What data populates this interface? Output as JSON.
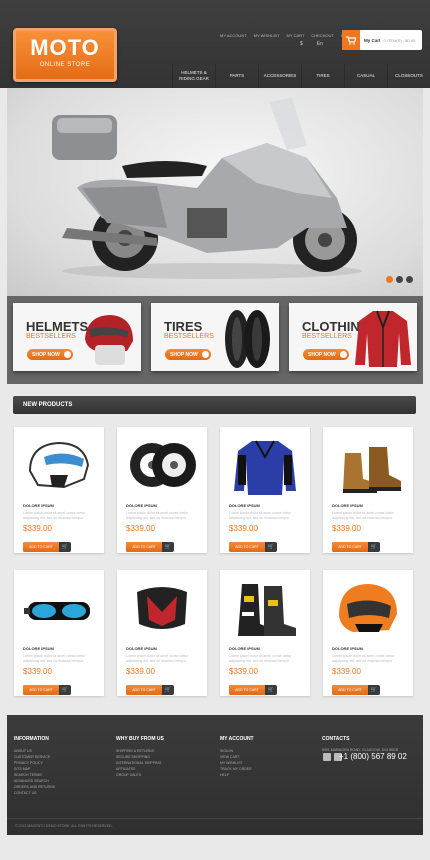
{
  "header": {
    "logo_title": "MOTO",
    "logo_subtitle": "ONLINE STORE",
    "top_links": [
      "MY ACCOUNT",
      "MY WISHLIST",
      "MY CART",
      "CHECKOUT",
      "LOG IN"
    ],
    "currency": "$",
    "language": "En",
    "cart_label": "My Cart",
    "cart_meta": "0 ITEM(S) - $0.00"
  },
  "nav": [
    "HELMETS & RIDING GEAR",
    "PARTS",
    "ACCESSORIES",
    "TIRES",
    "CASUAL",
    "CLOSEOUTS"
  ],
  "slider": {
    "slides": 3,
    "active": 1
  },
  "banners": [
    {
      "title": "HELMETS",
      "subtitle": "BESTSELLERS",
      "button": "SHOP NOW"
    },
    {
      "title": "TIRES",
      "subtitle": "BESTSELLERS",
      "button": "SHOP NOW"
    },
    {
      "title": "CLOTHING",
      "subtitle": "BESTSELLERS",
      "button": "SHOP NOW"
    }
  ],
  "section_title": "NEW PRODUCTS",
  "products": [
    {
      "name": "DOLORE IPSUM",
      "desc": "Lorem ipsum dolor sit amet conse ctetur adipisicing elit, sed do eiusmod tempor",
      "price": "$339.00",
      "button": "ADD TO CART"
    },
    {
      "name": "DOLORE IPSUM",
      "desc": "Lorem ipsum dolor sit amet conse ctetur adipisicing elit, sed do eiusmod tempor",
      "price": "$339.00",
      "button": "ADD TO CART"
    },
    {
      "name": "DOLORE IPSUM",
      "desc": "Lorem ipsum dolor sit amet conse ctetur adipisicing elit, sed do eiusmod tempor",
      "price": "$339.00",
      "button": "ADD TO CART"
    },
    {
      "name": "DOLORE IPSUM",
      "desc": "Lorem ipsum dolor sit amet conse ctetur adipisicing elit, sed do eiusmod tempor",
      "price": "$339.00",
      "button": "ADD TO CART"
    },
    {
      "name": "DOLORE IPSUM",
      "desc": "Lorem ipsum dolor sit amet conse ctetur adipisicing elit, sed do eiusmod tempor",
      "price": "$339.00",
      "button": "ADD TO CART"
    },
    {
      "name": "DOLORE IPSUM",
      "desc": "Lorem ipsum dolor sit amet conse ctetur adipisicing elit, sed do eiusmod tempor",
      "price": "$339.00",
      "button": "ADD TO CART"
    },
    {
      "name": "DOLORE IPSUM",
      "desc": "Lorem ipsum dolor sit amet conse ctetur adipisicing elit, sed do eiusmod tempor",
      "price": "$339.00",
      "button": "ADD TO CART"
    },
    {
      "name": "DOLORE IPSUM",
      "desc": "Lorem ipsum dolor sit amet conse ctetur adipisicing elit, sed do eiusmod tempor",
      "price": "$339.00",
      "button": "ADD TO CART"
    }
  ],
  "footer": {
    "information": {
      "title": "INFORMATION",
      "links": [
        "About Us",
        "Customer Service",
        "Privacy Policy",
        "Site Map",
        "Search Terms",
        "Advanced Search",
        "Orders and Returns",
        "Contact Us"
      ]
    },
    "why_buy": {
      "title": "WHY BUY FROM US",
      "links": [
        "Shipping & Returns",
        "Secure Shopping",
        "International Shipping",
        "Affiliates",
        "Group Sales"
      ]
    },
    "my_account": {
      "title": "MY ACCOUNT",
      "links": [
        "Sign In",
        "View Cart",
        "My Wishlist",
        "Track My Order",
        "Help"
      ]
    },
    "contacts": {
      "title": "CONTACTS",
      "address": "8901 MARMORA ROAD, GLASGOW, D04 89GR",
      "phone": "+1 (800) 567 89 02"
    },
    "copyright": "© 2013 MAGENTO DEMO STORE. ALL RIGHTS RESERVED."
  }
}
